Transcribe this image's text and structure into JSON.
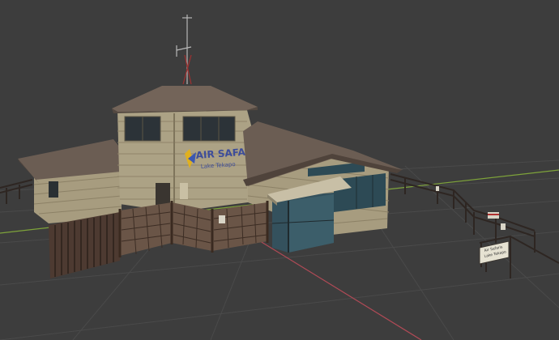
{
  "viewport": {
    "background": "#3d3d3d",
    "grid_color": "#4a4a4a",
    "axis_x_color": "#b04a56",
    "axis_y_color": "#7ea33a"
  },
  "model": {
    "name": "Air Safaris terminal building",
    "wall_color": "#a79c7f",
    "roof_color": "#6b5d53",
    "fence_color": "#4d3a31",
    "glass_color": "#34515d"
  },
  "signage": {
    "brand_name": "AIR SAFARIS",
    "brand_subtitle": "Lake Tekapo",
    "notice_line1": "Air Safaris",
    "notice_line2": "Lake Tekapo"
  }
}
